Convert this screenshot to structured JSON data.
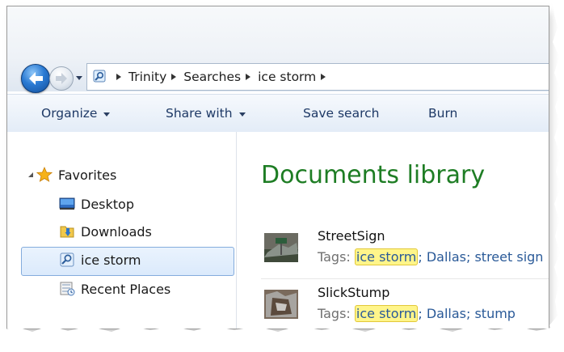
{
  "address_bar": {
    "crumbs": [
      "Trinity",
      "Searches",
      "ice storm"
    ]
  },
  "toolbar": {
    "organize": "Organize",
    "share_with": "Share with",
    "save_search": "Save search",
    "burn": "Burn"
  },
  "nav": {
    "favorites": "Favorites",
    "items": [
      {
        "label": "Desktop",
        "icon": "desktop-icon"
      },
      {
        "label": "Downloads",
        "icon": "downloads-folder-icon"
      },
      {
        "label": "ice storm",
        "icon": "saved-search-icon",
        "selected": true
      },
      {
        "label": "Recent Places",
        "icon": "recent-places-icon"
      }
    ]
  },
  "content": {
    "title": "Documents library",
    "files": [
      {
        "name": "StreetSign",
        "tags_label": "Tags:",
        "highlight": "ice storm",
        "tags_rest": "; Dallas; street sign"
      },
      {
        "name": "SlickStump",
        "tags_label": "Tags:",
        "highlight": "ice storm",
        "tags_rest": "; Dallas; stump"
      }
    ]
  },
  "colors": {
    "library_title": "#1e7d24",
    "tag_link": "#2a5a98",
    "search_highlight": "#fff58a",
    "toolbar_text": "#1e3966"
  }
}
